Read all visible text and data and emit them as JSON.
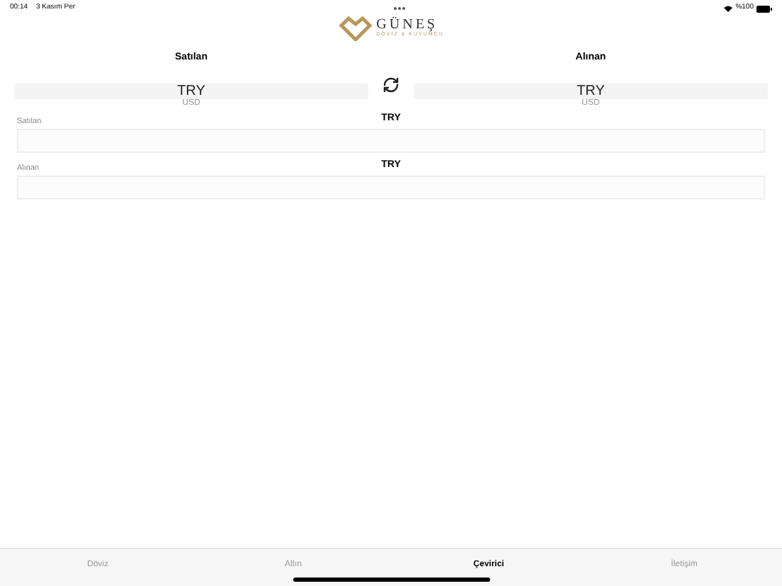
{
  "status_bar": {
    "time": "00:14",
    "date": "3 Kasım Per",
    "battery": "%100"
  },
  "logo": {
    "name": "GÜNEŞ",
    "tagline": "DÖVİZ & KUYUMCU"
  },
  "pickers": [
    {
      "label": "Satılan",
      "value": "TRY",
      "next": "USD"
    },
    {
      "label": "Alınan",
      "value": "TRY",
      "next": "USD"
    }
  ],
  "fields": [
    {
      "label": "Satılan",
      "currency": "TRY"
    },
    {
      "label": "Alınan",
      "currency": "TRY"
    }
  ],
  "tabs": [
    {
      "label": "Döviz",
      "selected": false
    },
    {
      "label": "Altın",
      "selected": false
    },
    {
      "label": "Çevirici",
      "selected": true
    },
    {
      "label": "İletişim",
      "selected": false
    }
  ]
}
